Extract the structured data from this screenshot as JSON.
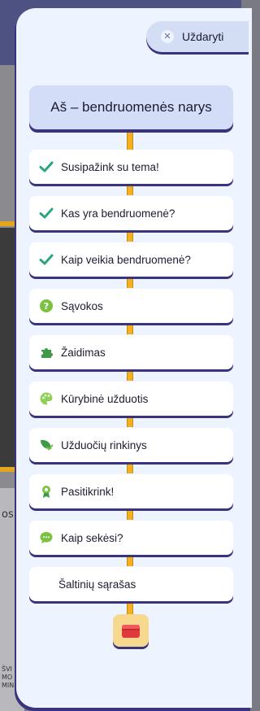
{
  "panel": {
    "close_label": "Uždaryti",
    "title": "Aš – bendruomenės narys"
  },
  "items": [
    {
      "label": "Susipažink su tema!",
      "icon": "check-icon",
      "done": true
    },
    {
      "label": "Kas yra bendruomenė?",
      "icon": "check-icon",
      "done": true
    },
    {
      "label": "Kaip veikia bendruomenė?",
      "icon": "check-icon",
      "done": true
    },
    {
      "label": "Sąvokos",
      "icon": "question-icon",
      "done": false
    },
    {
      "label": "Žaidimas",
      "icon": "puzzle-icon",
      "done": false
    },
    {
      "label": "Kūrybinė užduotis",
      "icon": "palette-icon",
      "done": false
    },
    {
      "label": "Užduočių rinkinys",
      "icon": "leaf-check-icon",
      "done": false
    },
    {
      "label": "Pasitikrink!",
      "icon": "medal-icon",
      "done": false
    },
    {
      "label": "Kaip sekėsi?",
      "icon": "chat-bubble-icon",
      "done": false
    },
    {
      "label": "Šaltinių sąrašas",
      "icon": "",
      "done": false
    }
  ],
  "background": {
    "fragment_1": "os",
    "fragment_2": "ŠVI",
    "fragment_3": "MO",
    "fragment_4": "MIN"
  },
  "colors": {
    "panel_bg": "#eef4ff",
    "accent_green": "#2aa57f",
    "connector": "#f3b01f",
    "shadow": "#3a3380"
  }
}
